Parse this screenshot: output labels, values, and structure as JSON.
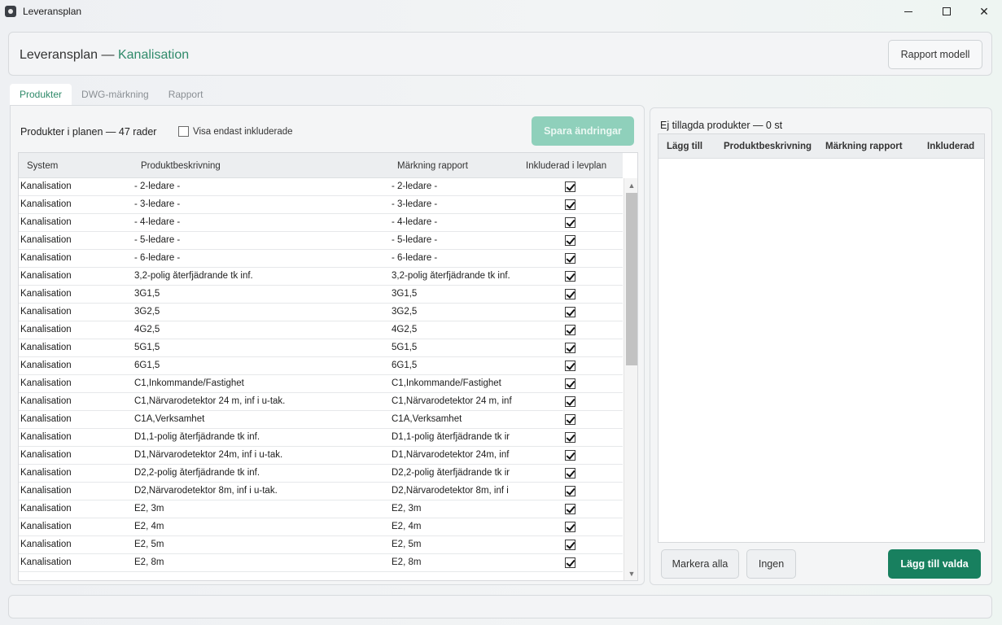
{
  "window": {
    "title": "Leveransplan"
  },
  "header": {
    "title": "Leveransplan —",
    "subtitle": "Kanalisation",
    "rapport_button": "Rapport modell"
  },
  "tabs": [
    {
      "label": "Produkter"
    },
    {
      "label": "DWG-märkning"
    },
    {
      "label": "Rapport"
    }
  ],
  "left": {
    "title": "Produkter i planen — 47 rader",
    "filter_label": "Visa endast inkluderade",
    "save_button": "Spara ändringar",
    "columns": {
      "system": "System",
      "desc": "Produktbeskrivning",
      "mark": "Märkning rapport",
      "included": "Inkluderad i levplan"
    },
    "rows": [
      {
        "system": "Kanalisation",
        "desc": "- 2-ledare -",
        "mark": "- 2-ledare -",
        "included": true
      },
      {
        "system": "Kanalisation",
        "desc": "- 3-ledare -",
        "mark": "- 3-ledare -",
        "included": true
      },
      {
        "system": "Kanalisation",
        "desc": "- 4-ledare -",
        "mark": "- 4-ledare -",
        "included": true
      },
      {
        "system": "Kanalisation",
        "desc": "- 5-ledare -",
        "mark": "- 5-ledare -",
        "included": true
      },
      {
        "system": "Kanalisation",
        "desc": "- 6-ledare -",
        "mark": "- 6-ledare -",
        "included": true
      },
      {
        "system": "Kanalisation",
        "desc": "3,2-polig återfjädrande tk inf.",
        "mark": "3,2-polig återfjädrande tk inf.",
        "included": true
      },
      {
        "system": "Kanalisation",
        "desc": "3G1,5",
        "mark": "3G1,5",
        "included": true
      },
      {
        "system": "Kanalisation",
        "desc": "3G2,5",
        "mark": "3G2,5",
        "included": true
      },
      {
        "system": "Kanalisation",
        "desc": "4G2,5",
        "mark": "4G2,5",
        "included": true
      },
      {
        "system": "Kanalisation",
        "desc": "5G1,5",
        "mark": "5G1,5",
        "included": true
      },
      {
        "system": "Kanalisation",
        "desc": "6G1,5",
        "mark": "6G1,5",
        "included": true
      },
      {
        "system": "Kanalisation",
        "desc": "C1,Inkommande/Fastighet",
        "mark": "C1,Inkommande/Fastighet",
        "included": true
      },
      {
        "system": "Kanalisation",
        "desc": "C1,Närvarodetektor 24 m, inf i u-tak.",
        "mark": "C1,Närvarodetektor 24 m, inf",
        "included": true
      },
      {
        "system": "Kanalisation",
        "desc": "C1A,Verksamhet",
        "mark": "C1A,Verksamhet",
        "included": true
      },
      {
        "system": "Kanalisation",
        "desc": "D1,1-polig återfjädrande tk inf.",
        "mark": "D1,1-polig återfjädrande tk ir",
        "included": true
      },
      {
        "system": "Kanalisation",
        "desc": "D1,Närvarodetektor 24m, inf i u-tak.",
        "mark": "D1,Närvarodetektor 24m, inf",
        "included": true
      },
      {
        "system": "Kanalisation",
        "desc": "D2,2-polig återfjädrande tk inf.",
        "mark": "D2,2-polig återfjädrande tk ir",
        "included": true
      },
      {
        "system": "Kanalisation",
        "desc": "D2,Närvarodetektor 8m, inf i u-tak.",
        "mark": "D2,Närvarodetektor 8m, inf i",
        "included": true
      },
      {
        "system": "Kanalisation",
        "desc": "E2, 3m",
        "mark": "E2, 3m",
        "included": true
      },
      {
        "system": "Kanalisation",
        "desc": "E2, 4m",
        "mark": "E2, 4m",
        "included": true
      },
      {
        "system": "Kanalisation",
        "desc": "E2, 5m",
        "mark": "E2, 5m",
        "included": true
      },
      {
        "system": "Kanalisation",
        "desc": "E2, 8m",
        "mark": "E2, 8m",
        "included": true
      }
    ]
  },
  "right": {
    "title": "Ej tillagda produkter — 0 st",
    "columns": {
      "add": "Lägg till",
      "desc": "Produktbeskrivning",
      "mark": "Märkning rapport",
      "included": "Inkluderad"
    },
    "select_all_button": "Markera alla",
    "none_button": "Ingen",
    "add_selected_button": "Lägg till valda"
  },
  "colors": {
    "accent": "#2f8a6a",
    "primary_button": "#18805f",
    "disabled_button": "#8fd0bb"
  }
}
